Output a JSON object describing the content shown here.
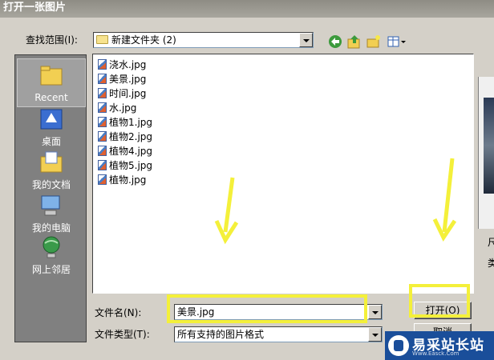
{
  "dialog": {
    "title": "打开一张图片"
  },
  "lookin": {
    "label": "查找范围(I):",
    "value": "新建文件夹 (2)"
  },
  "toolbar": {
    "back_icon": "back-arrow-icon",
    "up_icon": "up-folder-icon",
    "newfolder_icon": "new-folder-icon",
    "view_icon": "view-menu-icon"
  },
  "places": [
    {
      "label": "Recent",
      "icon": "recent-icon"
    },
    {
      "label": "桌面",
      "icon": "desktop-icon"
    },
    {
      "label": "我的文档",
      "icon": "my-documents-icon"
    },
    {
      "label": "我的电脑",
      "icon": "my-computer-icon"
    },
    {
      "label": "网上邻居",
      "icon": "network-places-icon"
    }
  ],
  "files": [
    "浇水.jpg",
    "美景.jpg",
    "时间.jpg",
    "水.jpg",
    "植物1.jpg",
    "植物2.jpg",
    "植物4.jpg",
    "植物5.jpg",
    "植物.jpg"
  ],
  "filename": {
    "label": "文件名(N):",
    "value": "美景.jpg"
  },
  "filetype": {
    "label": "文件类型(T):",
    "value": "所有支持的图片格式"
  },
  "buttons": {
    "open": "打开(O)",
    "cancel": "取消"
  },
  "preview_edge": {
    "line1": "尺",
    "line2": "类"
  },
  "watermark": {
    "text": "易采站长站",
    "sub": "Www.Easck.Com"
  },
  "colors": {
    "highlight": "#f4f03a",
    "arrow": "#f4f03a",
    "titlebar": "#8e8c84"
  }
}
